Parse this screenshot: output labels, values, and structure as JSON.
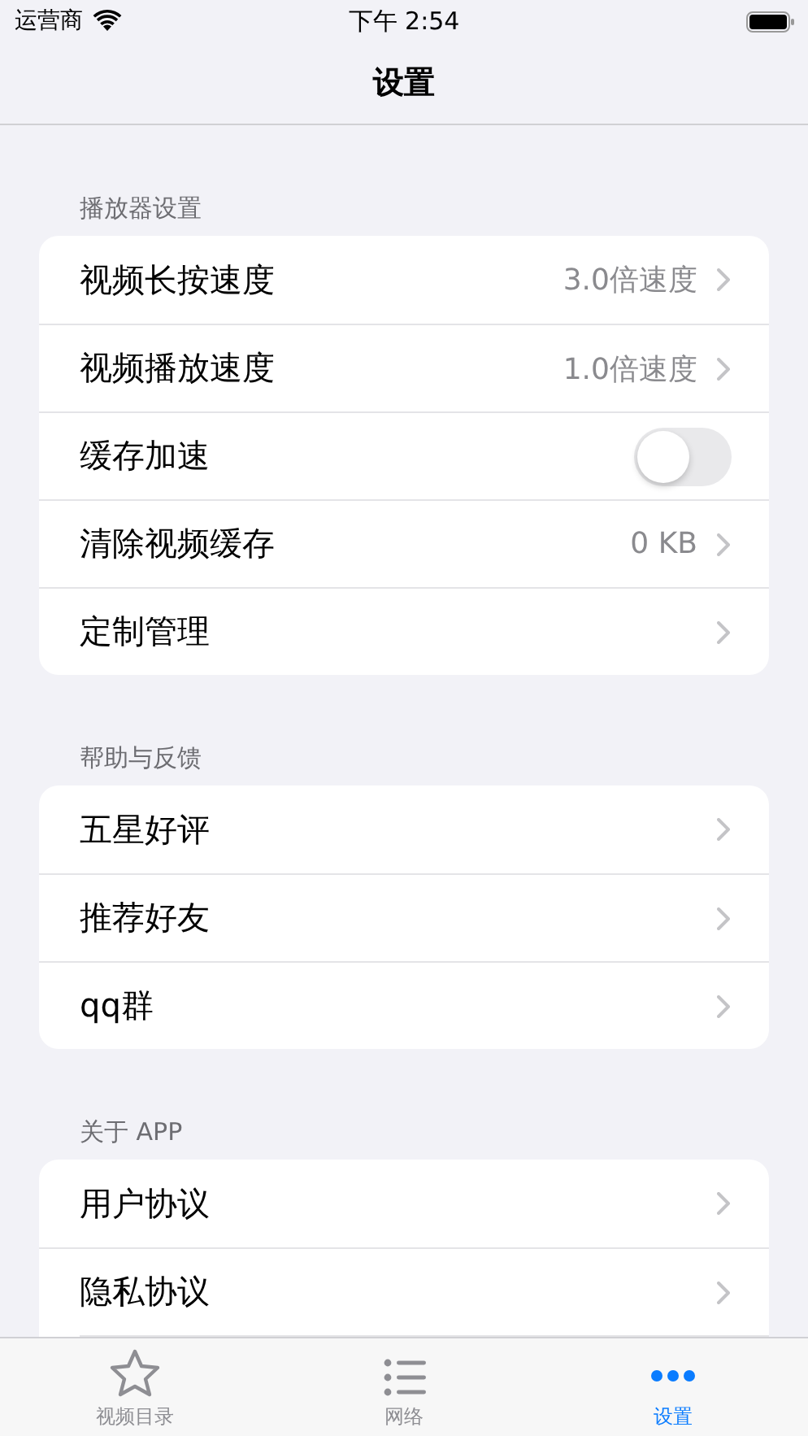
{
  "status_bar": {
    "carrier": "运营商",
    "time": "下午 2:54"
  },
  "nav": {
    "title": "设置"
  },
  "sections": [
    {
      "header": "播放器设置",
      "rows": [
        {
          "kind": "value",
          "label": "视频长按速度",
          "value": "3.0倍速度"
        },
        {
          "kind": "value",
          "label": "视频播放速度",
          "value": "1.0倍速度"
        },
        {
          "kind": "toggle",
          "label": "缓存加速",
          "on": false
        },
        {
          "kind": "value",
          "label": "清除视频缓存",
          "value": "0 KB"
        },
        {
          "kind": "link",
          "label": "定制管理"
        }
      ]
    },
    {
      "header": "帮助与反馈",
      "rows": [
        {
          "kind": "link",
          "label": "五星好评"
        },
        {
          "kind": "link",
          "label": "推荐好友"
        },
        {
          "kind": "link",
          "label": "qq群"
        }
      ]
    },
    {
      "header": "关于 APP",
      "rows": [
        {
          "kind": "link",
          "label": "用户协议"
        },
        {
          "kind": "link",
          "label": "隐私协议"
        }
      ]
    }
  ],
  "tab_bar": [
    {
      "kind": "star",
      "label": "视频目录",
      "selected": false
    },
    {
      "kind": "list",
      "label": "网络",
      "selected": false
    },
    {
      "kind": "more",
      "label": "设置",
      "selected": true
    }
  ]
}
